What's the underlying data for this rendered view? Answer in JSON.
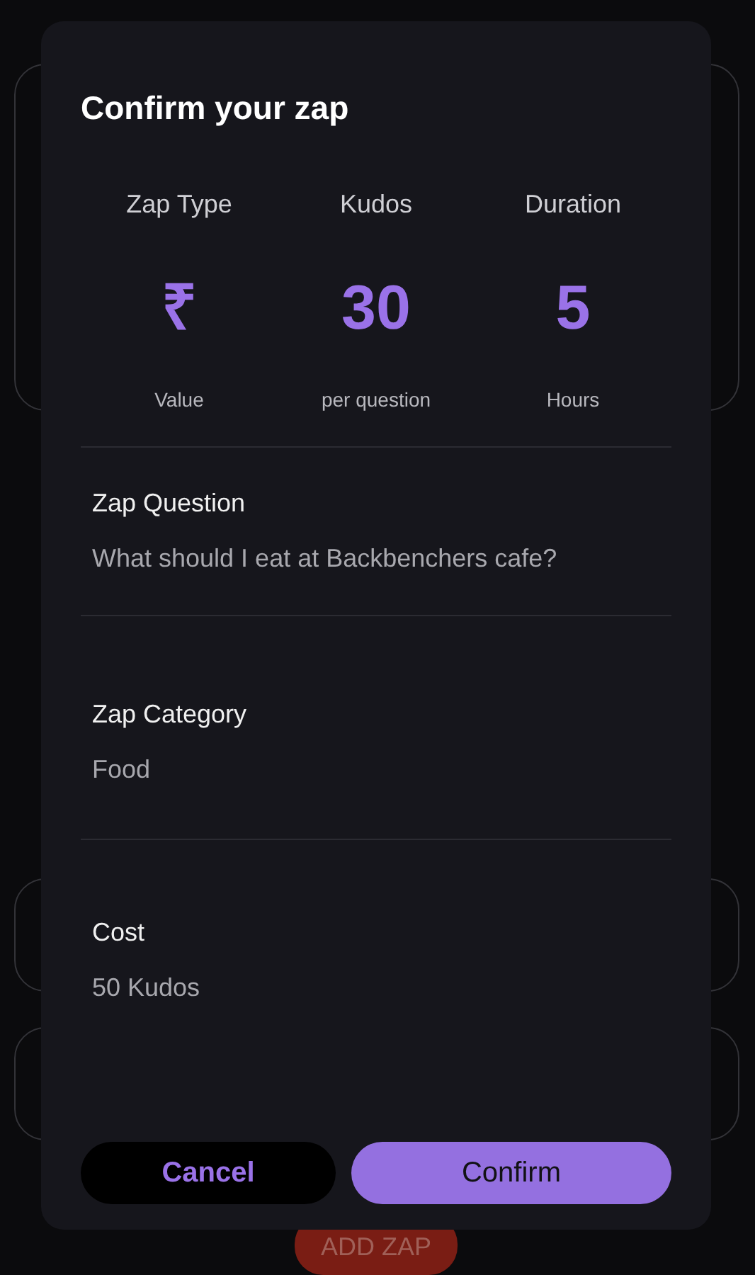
{
  "background": {
    "add_button": "ADD ZAP"
  },
  "dialog": {
    "title": "Confirm your zap",
    "stats": [
      {
        "label": "Zap Type",
        "value": "₹",
        "caption": "Value"
      },
      {
        "label": "Kudos",
        "value": "30",
        "caption": "per question"
      },
      {
        "label": "Duration",
        "value": "5",
        "caption": "Hours"
      }
    ],
    "sections": [
      {
        "label": "Zap Question",
        "value": "What should I eat at Backbenchers cafe?"
      },
      {
        "label": "Zap Category",
        "value": "Food"
      },
      {
        "label": "Cost",
        "value": "50 Kudos"
      }
    ],
    "buttons": [
      {
        "label": "Cancel",
        "kind": "secondary"
      },
      {
        "label": "Confirm",
        "kind": "primary"
      }
    ]
  }
}
